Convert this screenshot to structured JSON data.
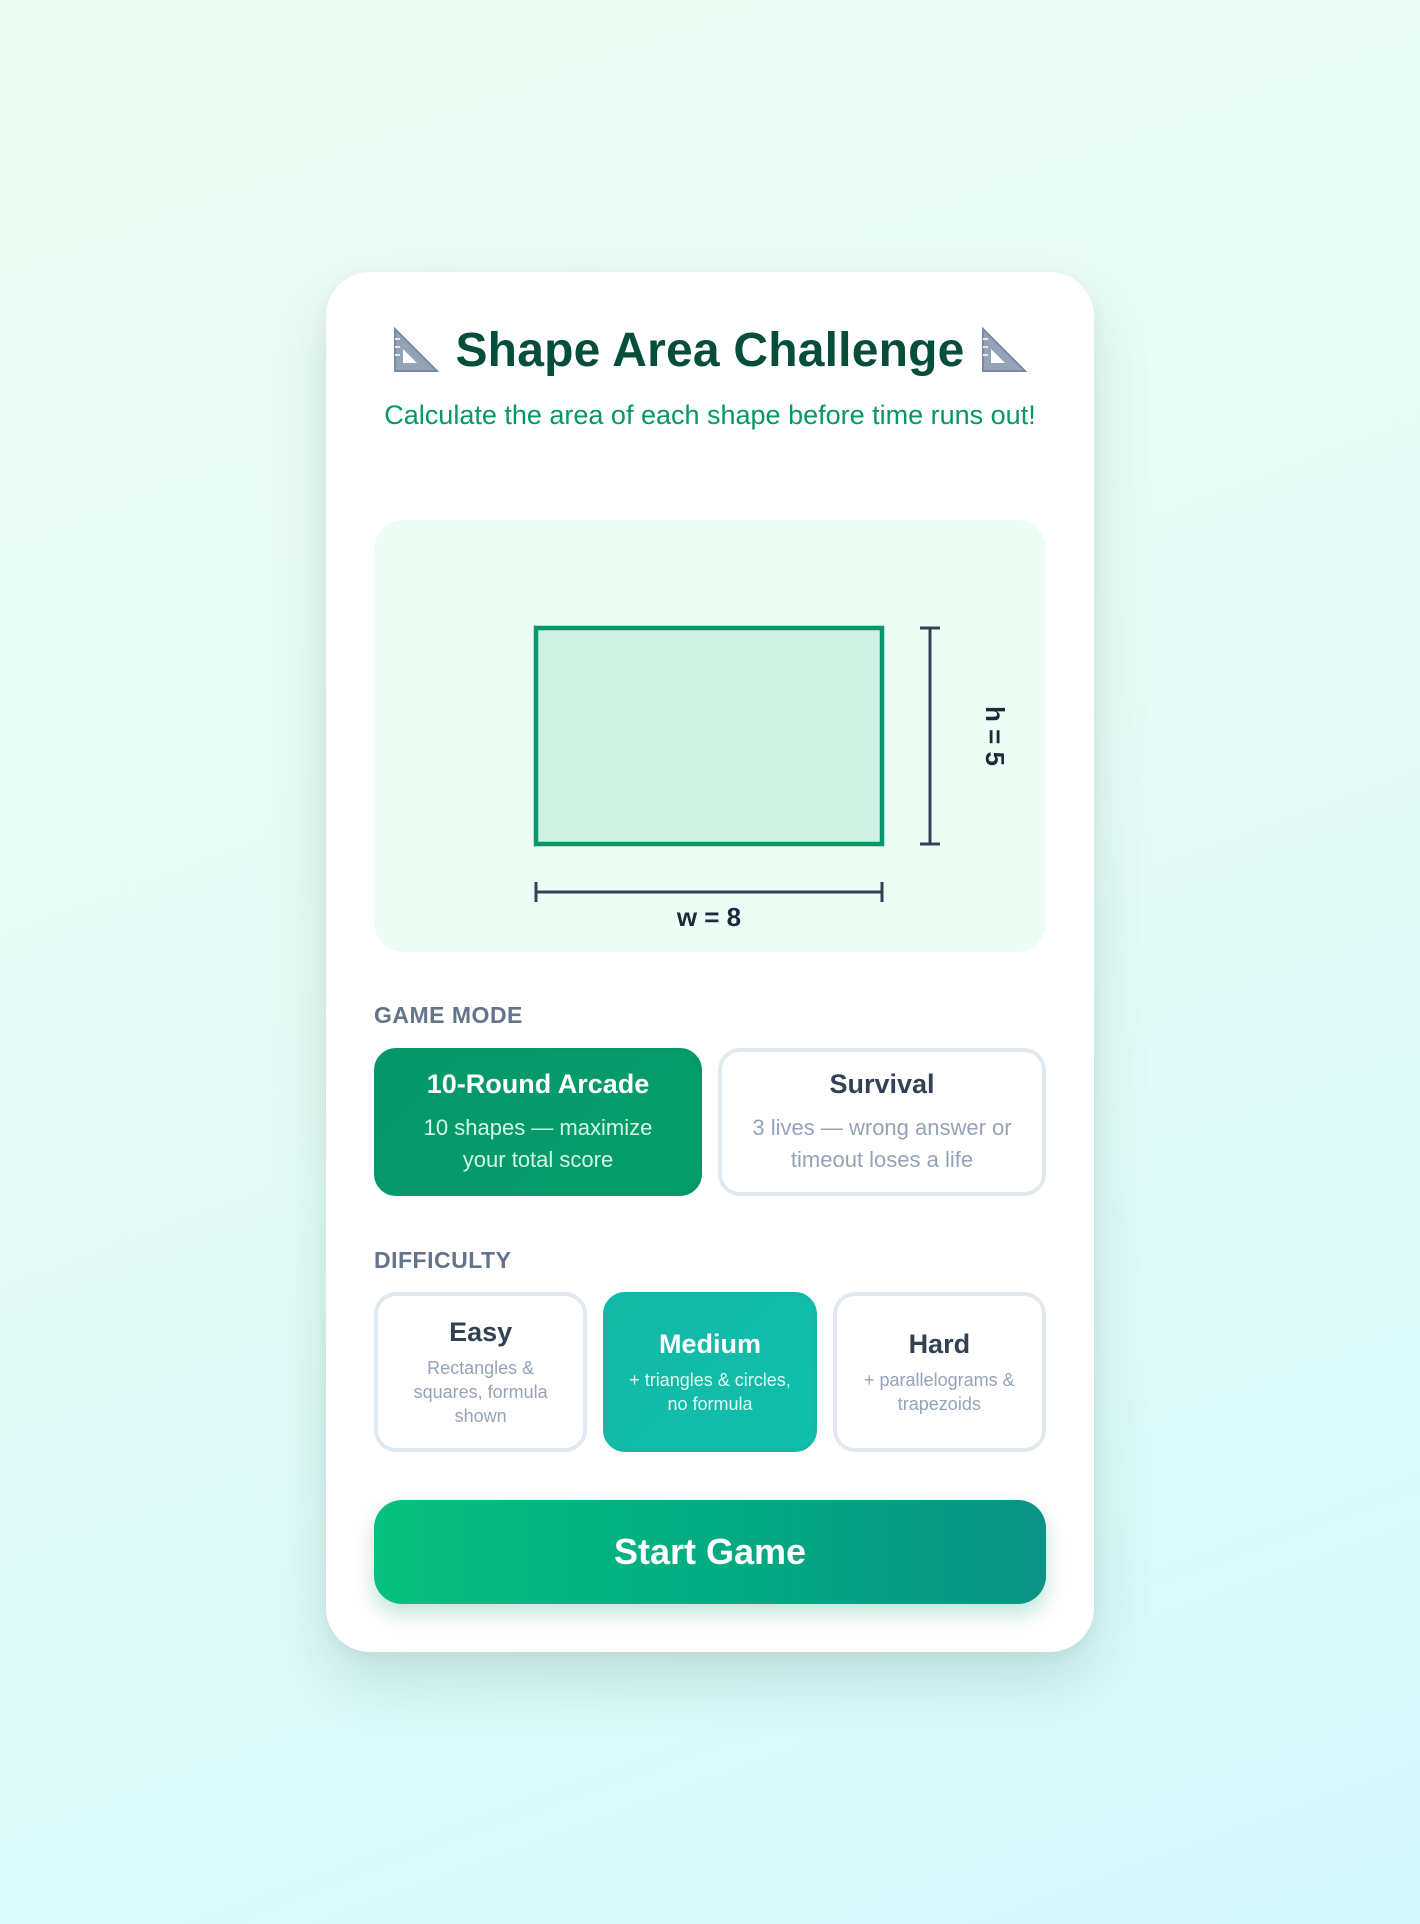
{
  "header": {
    "title": "Shape Area Challenge",
    "subtitle": "Calculate the area of each shape before time runs out!",
    "icon": "triangular-ruler-icon"
  },
  "shape": {
    "type": "rectangle",
    "width": 8,
    "height": 5,
    "width_label": "w = 8",
    "height_label": "h = 5",
    "fill_color": "#cff2e4",
    "stroke_color": "#059669",
    "dimension_color": "#334155"
  },
  "game_mode": {
    "label": "GAME MODE",
    "options": [
      {
        "name": "10-Round Arcade",
        "description": "10 shapes — maximize your total score",
        "selected": true
      },
      {
        "name": "Survival",
        "description": "3 lives — wrong answer or timeout loses a life",
        "selected": false
      }
    ]
  },
  "difficulty": {
    "label": "DIFFICULTY",
    "options": [
      {
        "name": "Easy",
        "description": "Rectangles & squares, formula shown",
        "selected": false
      },
      {
        "name": "Medium",
        "description": "+ triangles & circles, no formula",
        "selected": true
      },
      {
        "name": "Hard",
        "description": "+ parallelograms & trapezoids",
        "selected": false
      }
    ]
  },
  "start_button": {
    "label": "Start Game"
  },
  "colors": {
    "primary": "#059669",
    "accent": "#14b8a6",
    "title": "#064e3b"
  }
}
